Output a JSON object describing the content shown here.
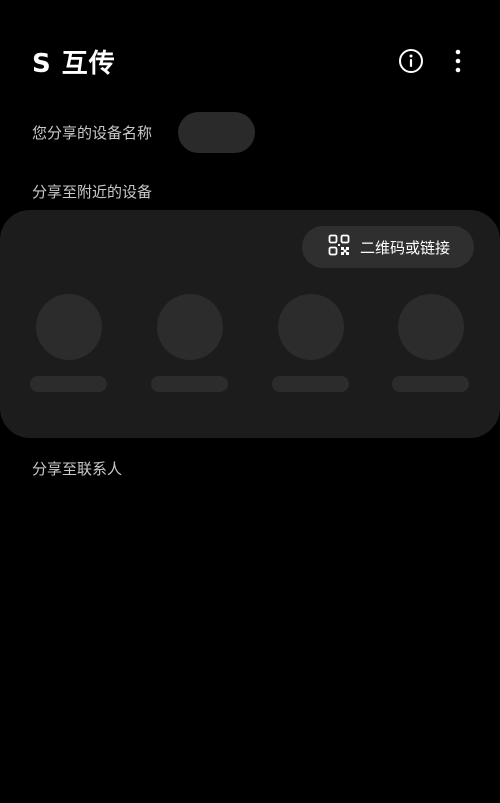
{
  "app": {
    "title": "S 互传"
  },
  "toolbar": {
    "info_icon": "info-circle-icon",
    "more_icon": "more-vertical-icon"
  },
  "device_name": {
    "label": "您分享的设备名称",
    "value": ""
  },
  "nearby": {
    "label": "分享至附近的设备",
    "qr_button_label": "二维码或链接",
    "qr_icon": "qr-code-icon",
    "devices": [
      {
        "name": ""
      },
      {
        "name": ""
      },
      {
        "name": ""
      },
      {
        "name": ""
      }
    ]
  },
  "contacts": {
    "label": "分享至联系人"
  },
  "colors": {
    "background": "#000000",
    "card": "#1c1c1c",
    "placeholder": "#2c2c2c",
    "button": "#2f2f2f",
    "label_text": "#c9c9c9"
  }
}
